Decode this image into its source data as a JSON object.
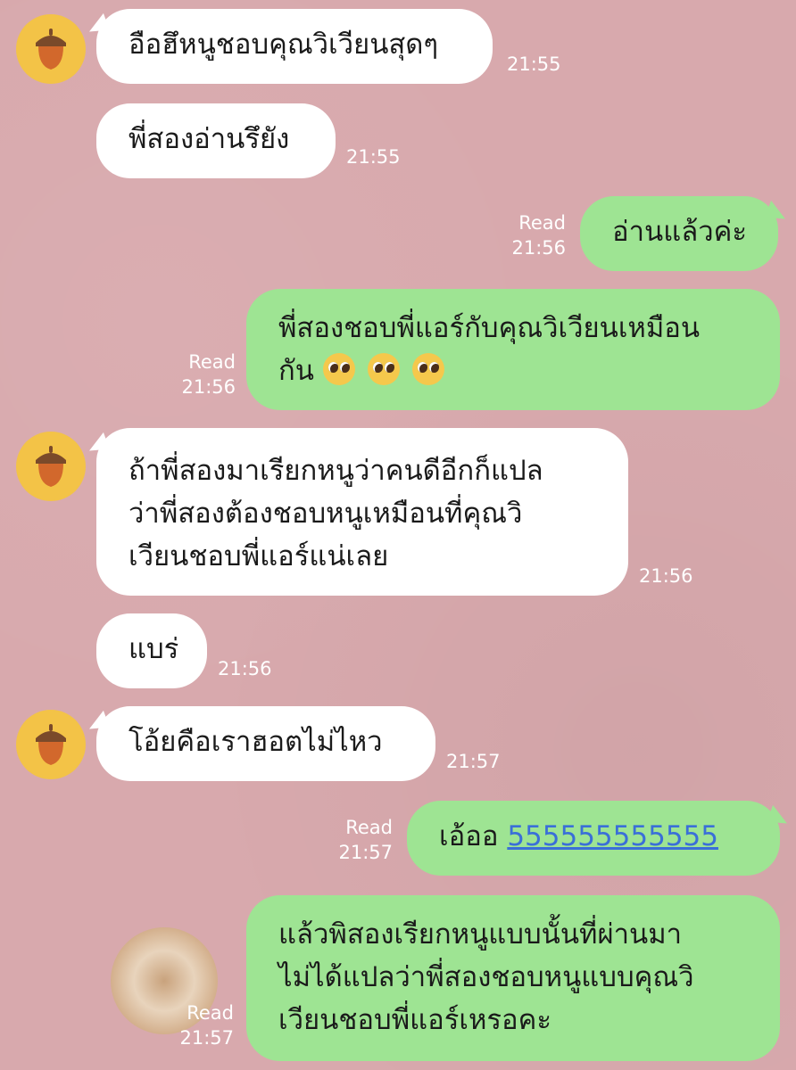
{
  "chat": {
    "messages": [
      {
        "side": "in",
        "lines": [
          "อือฮึหนูชอบคุณวิเวียนสุดๆ"
        ],
        "time": "21:55"
      },
      {
        "side": "in",
        "lines": [
          "พี่สองอ่านรึยัง"
        ],
        "time": "21:55"
      },
      {
        "side": "out",
        "lines": [
          "อ่านแล้วค่ะ"
        ],
        "read": "Read",
        "time": "21:56"
      },
      {
        "side": "out",
        "lines": [
          "พี่สองชอบพี่แอร์กับคุณวิเวียนเหมือน",
          "กัน"
        ],
        "read": "Read",
        "time": "21:56",
        "emoji": [
          "pleading-face-emoji",
          "pleading-face-emoji",
          "pleading-face-emoji"
        ]
      },
      {
        "side": "in",
        "lines": [
          "ถ้าพี่สองมาเรียกหนูว่าคนดีอีกก็แปล",
          "ว่าพี่สองต้องชอบหนูเหมือนที่คุณวิ",
          "เวียนชอบพี่แอร์แน่เลย"
        ],
        "time": "21:56"
      },
      {
        "side": "in",
        "lines": [
          "แบร่"
        ],
        "time": "21:56"
      },
      {
        "side": "in",
        "lines": [
          "โอ้ยคือเราฮอตไม่ไหว"
        ],
        "time": "21:57"
      },
      {
        "side": "out",
        "lines": [
          "เอ้ออ"
        ],
        "link": "555555555555",
        "read": "Read",
        "time": "21:57"
      },
      {
        "side": "out",
        "lines": [
          "แล้วพิสองเรียกหนูแบบนั้นที่ผ่านมา",
          "ไม่ได้แปลว่าพี่สองชอบหนูแบบคุณวิ",
          "เวียนชอบพี่แอร์เหรอคะ"
        ],
        "read": "Read",
        "time": "21:57"
      }
    ]
  },
  "colors": {
    "background": "#d8a9ad",
    "incoming_bubble": "#ffffff",
    "outgoing_bubble": "#9ee493",
    "avatar_bg": "#f3c347",
    "link": "#3a6fd8"
  },
  "icons": {
    "avatar": "acorn-icon"
  }
}
